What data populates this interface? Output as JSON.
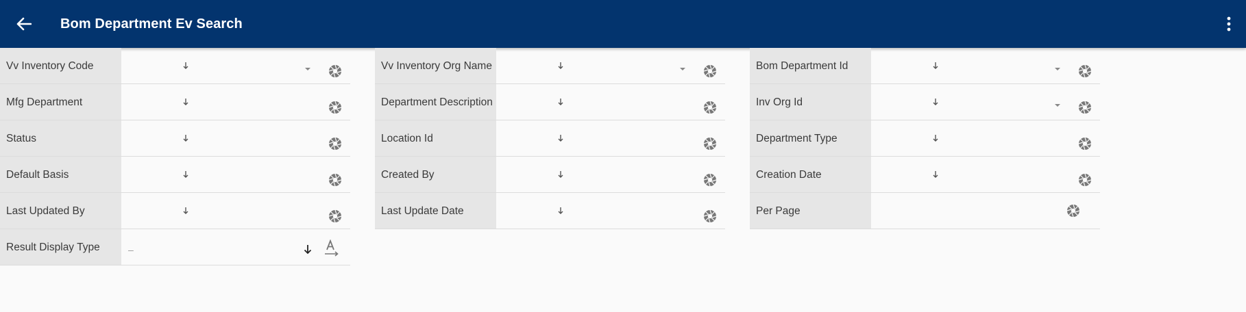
{
  "header": {
    "title": "Bom Department Ev  Search",
    "back_icon": "arrow-left-icon",
    "menu_icon": "more-vert-icon"
  },
  "colors": {
    "appbar": "#03346e",
    "label_bg": "#e6e6e6",
    "page_bg": "#fafafa"
  },
  "columns": [
    {
      "rows": [
        {
          "label": "Vv Inventory Code",
          "has_caret": true
        },
        {
          "label": "Mfg Department",
          "has_caret": false
        },
        {
          "label": "Status",
          "has_caret": false
        },
        {
          "label": "Default Basis",
          "has_caret": false
        },
        {
          "label": "Last Updated By",
          "has_caret": false
        },
        {
          "label": "Result Display Type",
          "value": "–"
        }
      ]
    },
    {
      "rows": [
        {
          "label": "Vv Inventory Org Name",
          "has_caret": true
        },
        {
          "label": "Department Description",
          "has_caret": false
        },
        {
          "label": "Location Id",
          "has_caret": false
        },
        {
          "label": "Created By",
          "has_caret": false
        },
        {
          "label": "Last Update Date",
          "has_caret": false
        }
      ]
    },
    {
      "rows": [
        {
          "label": "Bom Department Id",
          "has_caret": true
        },
        {
          "label": "Inv Org Id",
          "has_caret": true
        },
        {
          "label": "Department Type",
          "has_caret": false
        },
        {
          "label": "Creation Date",
          "has_caret": false
        },
        {
          "label": "Per Page",
          "has_caret": false
        }
      ]
    }
  ]
}
